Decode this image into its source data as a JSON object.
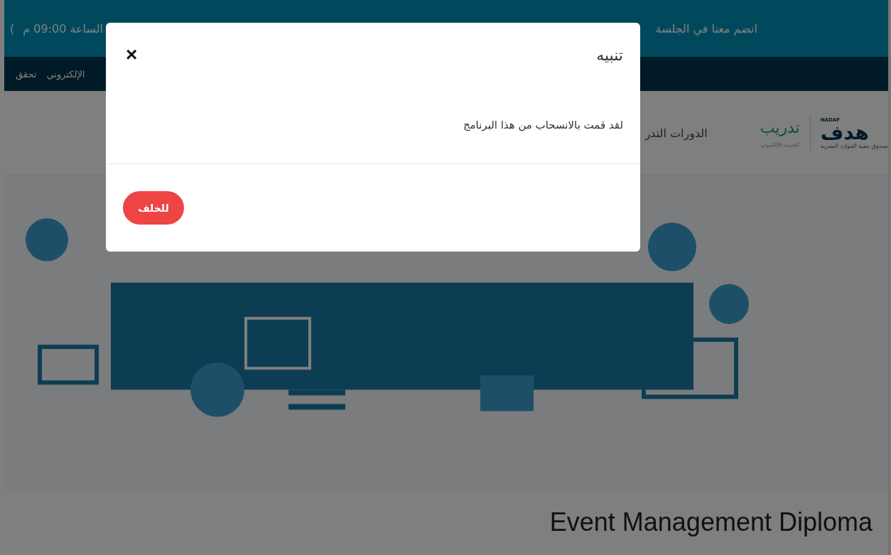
{
  "announcement": {
    "text_right": "انضم معنا في الجلسة",
    "text_left": "الساعة 09:00 م",
    "bracket": "("
  },
  "nav": {
    "links": [
      "الإلكتروني",
      "تحقق"
    ]
  },
  "header": {
    "logo_latin": "HADAF",
    "logo_arabic": "هدف",
    "logo_tagline": "صندوق تنمية الموارد البشرية",
    "brand": "تدريب",
    "brand_sub": "التدريب الإلكتروني",
    "menu_item": "الدورات التدر"
  },
  "page_title": "Event Management Diploma",
  "modal": {
    "title": "تنبيه",
    "close": "×",
    "message": "لقد قمت بالانسحاب من هذا البرنامج",
    "back_button": "للخلف"
  }
}
